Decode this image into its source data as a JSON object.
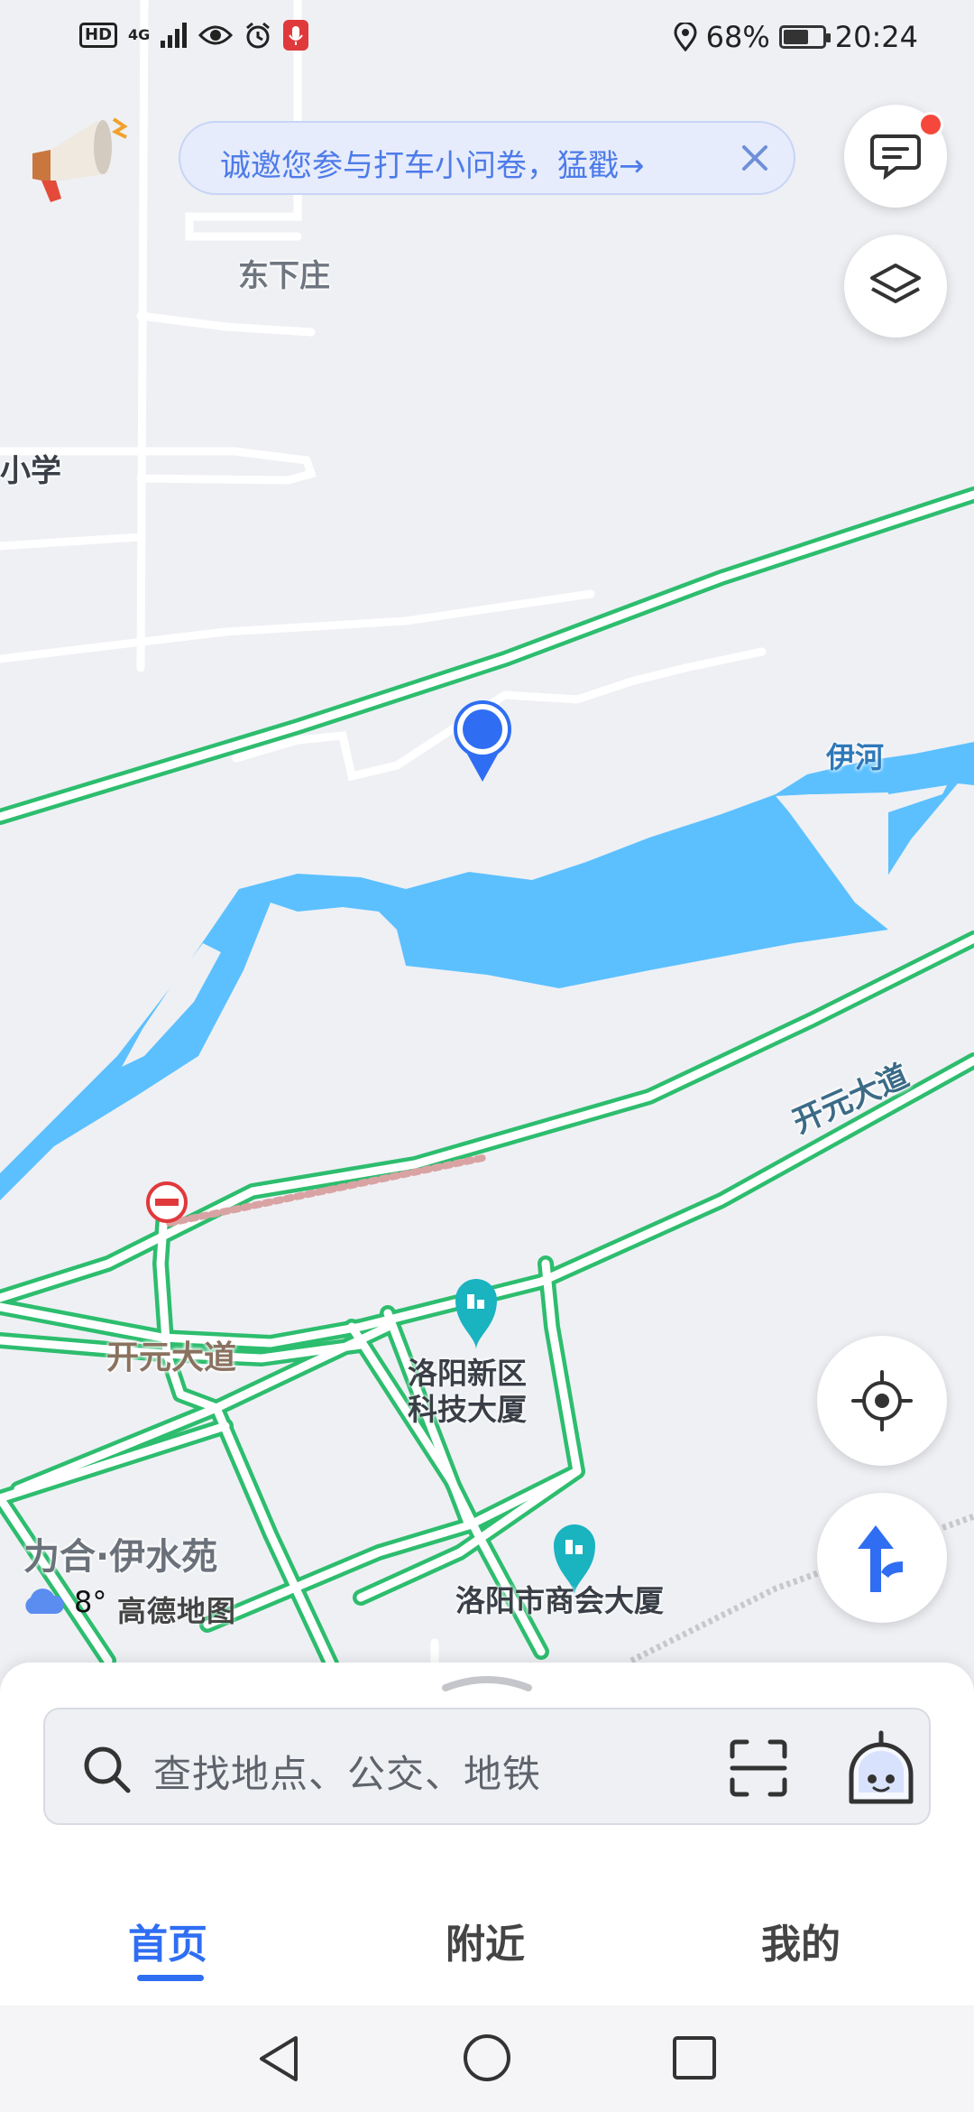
{
  "status_bar": {
    "left_badge": "HD",
    "network": "4G",
    "battery_percent": "68%",
    "battery_level": 0.68,
    "time": "20:24"
  },
  "banner": {
    "text": "诚邀您参与打车小问卷，猛戳→"
  },
  "map": {
    "place_labels": {
      "dongxiazhuang": "东下庄",
      "xiaoxue": "小学",
      "yihe": "伊河",
      "kaiyuan_road_east": "开元大道",
      "kaiyuan_road_west": "开元大道",
      "lihe_yishuiyuan": "力合·伊水苑"
    },
    "pois": {
      "tech_building": "洛阳新区\n科技大厦",
      "chamber_building": "洛阳市商会大厦"
    },
    "weather": {
      "temperature": "8°",
      "brand": "高德地图"
    }
  },
  "search": {
    "placeholder": "查找地点、公交、地铁"
  },
  "tabs": {
    "home": "首页",
    "nearby": "附近",
    "mine": "我的"
  },
  "colors": {
    "accent": "#2f6ef2",
    "road": "#2dbd6e",
    "water": "#5cc0ff",
    "map_bg": "#eef0f4",
    "notify_dot": "#f5473b"
  }
}
